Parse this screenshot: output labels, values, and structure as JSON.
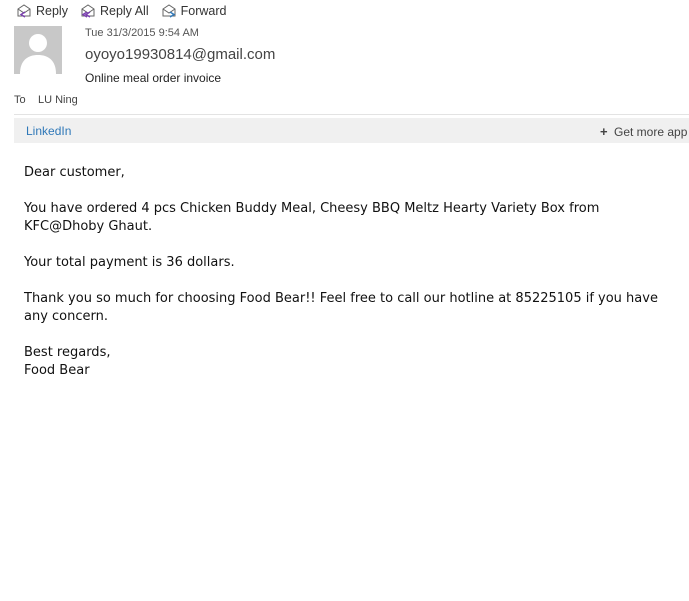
{
  "toolbar": {
    "reply_label": "Reply",
    "reply_all_label": "Reply All",
    "forward_label": "Forward",
    "reply_icon": "reply-icon",
    "reply_all_icon": "reply-all-icon",
    "forward_icon": "forward-icon"
  },
  "message": {
    "date": "Tue 31/3/2015 9:54 AM",
    "from": "oyoyo19930814@gmail.com",
    "subject": "Online meal order invoice",
    "to_label": "To",
    "to_value": "LU Ning"
  },
  "addins": {
    "linkedin_label": "LinkedIn",
    "get_more_label": "Get more app"
  },
  "body": {
    "greeting": "Dear customer,",
    "order_line": "You have ordered 4 pcs Chicken Buddy Meal, Cheesy BBQ Meltz Hearty Variety Box from KFC@Dhoby Ghaut.",
    "payment_line": "Your total payment is 36 dollars.",
    "thanks_line": "Thank you so much for choosing Food Bear!! Feel free to call our hotline at 85225105 if you have any concern.",
    "closing": "Best regards,",
    "signature": "Food Bear"
  },
  "colors": {
    "link": "#2f78b8",
    "addin_bar_bg": "#f0f0f0",
    "avatar_bg": "#c8c8c8"
  }
}
